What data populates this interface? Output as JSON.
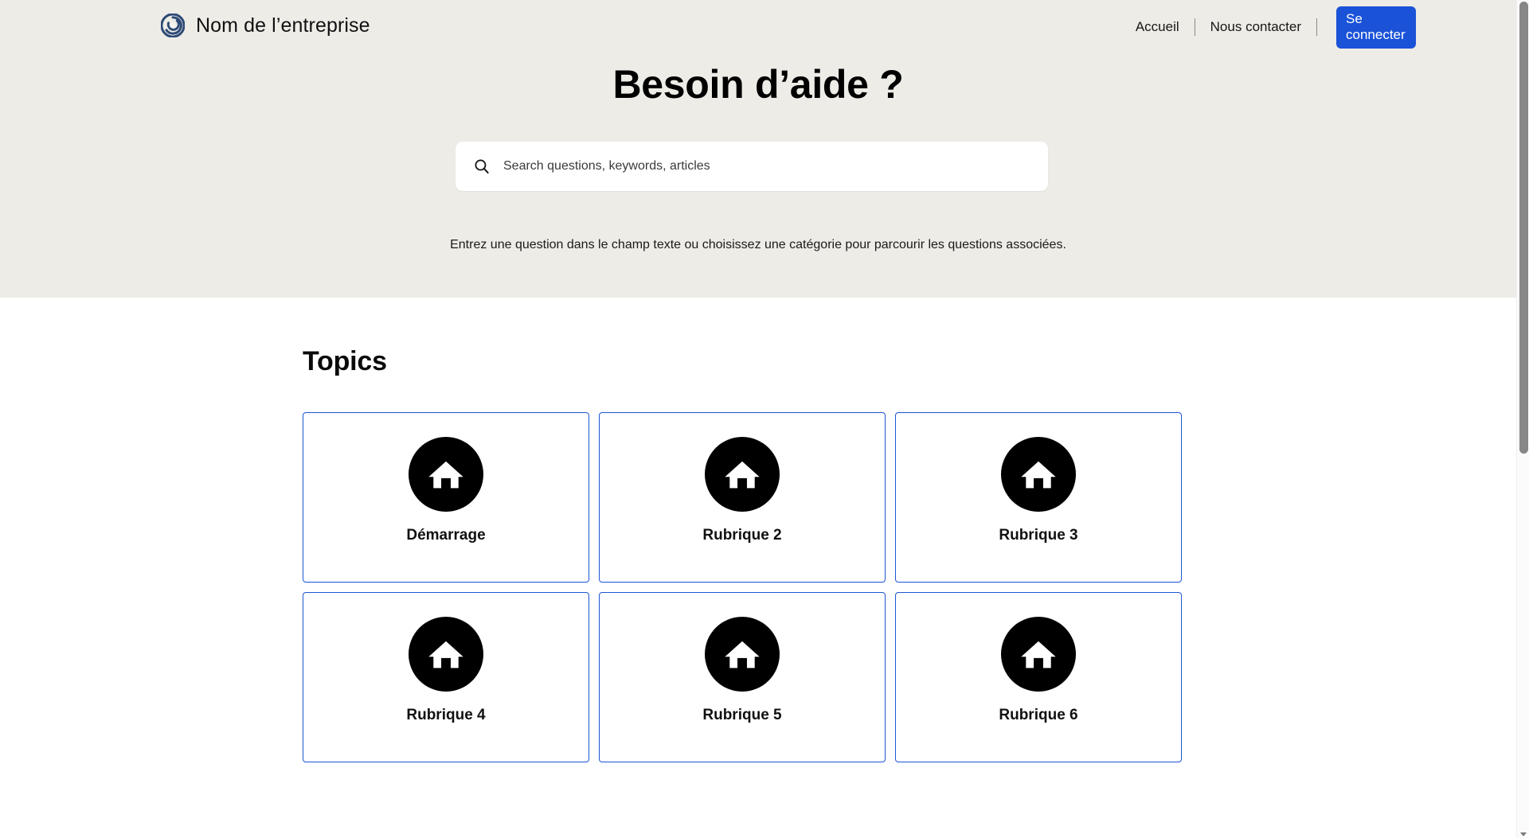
{
  "header": {
    "brand_name": "Nom de l’entreprise",
    "brand_icon": "spiral-logo-icon",
    "brand_color": "#2d4a75",
    "nav": [
      {
        "label": "Accueil",
        "name": "accueil"
      },
      {
        "label": "Nous contacter",
        "name": "nous-contacter"
      }
    ],
    "cta": {
      "label": "Se connecter",
      "color": "#1a52d8",
      "text_color": "#ffffff"
    }
  },
  "hero": {
    "title": "Besoin d’aide ?",
    "background_color": "#eeece7",
    "search": {
      "icon": "search-icon",
      "placeholder": "Search questions, keywords, articles",
      "value": ""
    },
    "subtitle": "Entrez une question dans le champ texte ou choisissez une catégorie pour parcourir les questions associées."
  },
  "topics": {
    "heading": "Topics",
    "card_border_color": "#1b55d6",
    "icon_background": "#000000",
    "items": [
      {
        "label": "Démarrage",
        "icon": "home-icon"
      },
      {
        "label": "Rubrique 2",
        "icon": "home-icon"
      },
      {
        "label": "Rubrique 3",
        "icon": "home-icon"
      },
      {
        "label": "Rubrique 4",
        "icon": "home-icon"
      },
      {
        "label": "Rubrique 5",
        "icon": "home-icon"
      },
      {
        "label": "Rubrique 6",
        "icon": "home-icon"
      }
    ]
  },
  "scrollbar": {
    "thumb_color": "#878787",
    "down_arrow_icon": "chevron-down-icon"
  }
}
